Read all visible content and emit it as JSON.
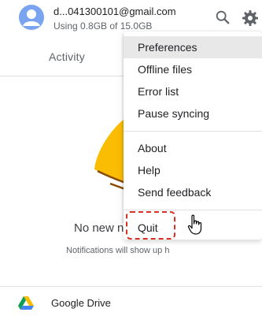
{
  "header": {
    "email": "d...041300101@gmail.com",
    "storage": "Using 0.8GB of 15.0GB"
  },
  "tabs": {
    "activity": "Activity"
  },
  "empty_state": {
    "title": "No new n",
    "subtitle": "Notifications will show up h"
  },
  "menu": {
    "items": [
      "Preferences",
      "Offline files",
      "Error list",
      "Pause syncing",
      "About",
      "Help",
      "Send feedback",
      "Quit"
    ]
  },
  "footer": {
    "label": "Google Drive"
  },
  "icons": {
    "avatar": "person-avatar-icon",
    "search": "search-icon",
    "settings": "gear-icon",
    "bell": "bell-icon",
    "drive": "google-drive-logo",
    "cursor": "hand-cursor-icon"
  },
  "colors": {
    "accent": "#4285f4",
    "highlight_outline": "#d93025",
    "bell": "#fbbc04"
  }
}
